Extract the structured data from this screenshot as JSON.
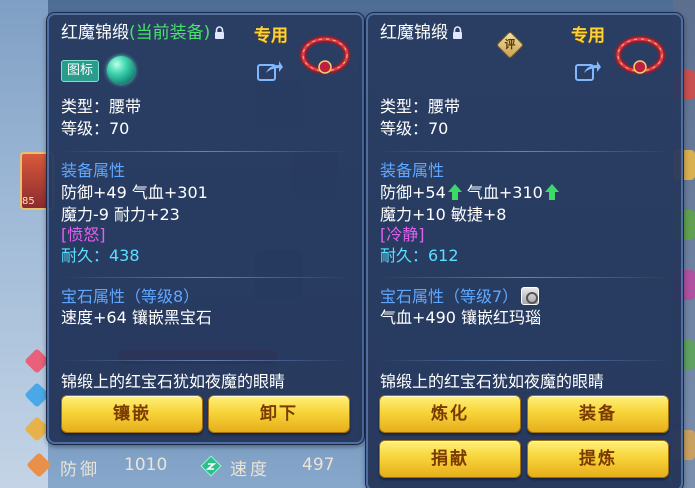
{
  "background": {
    "character_level": "85",
    "bottom_stats": [
      {
        "label": "防御",
        "value": "1010"
      },
      {
        "label": "速度",
        "value": "497"
      }
    ]
  },
  "left_panel": {
    "item_name": "红魔锦缎",
    "current_equipped": "(当前装备)",
    "exclusive": "专用",
    "tag": "图标",
    "type_line": "类型：腰带",
    "level_line": "等级：70",
    "attr_title": "装备属性",
    "attr_line1": "防御+49 气血+301",
    "attr_line2": "魔力-9 耐力+23",
    "trait": "[愤怒]",
    "durability": "耐久：438",
    "gem_title": "宝石属性（等级8）",
    "gem_line": "速度+64 镶嵌黑宝石",
    "flavor": "锦缎上的红宝石犹如夜魔的眼睛",
    "buttons": [
      "镶嵌",
      "卸下"
    ]
  },
  "right_panel": {
    "item_name": "红魔锦缎",
    "ping_badge": "评",
    "exclusive": "专用",
    "type_line": "类型：腰带",
    "level_line": "等级：70",
    "attr_title": "装备属性",
    "attr_line1_a": "防御+54",
    "attr_line1_b": "气血+310",
    "attr_line2": "魔力+10 敏捷+8",
    "trait": "[冷静]",
    "durability": "耐久：612",
    "gem_title": "宝石属性（等级7）",
    "gem_line": "气血+490 镶嵌红玛瑙",
    "flavor": "锦缎上的红宝石犹如夜魔的眼睛",
    "buttons": [
      "炼化",
      "装备",
      "捐献",
      "提炼"
    ]
  },
  "colors": {
    "current_equipped": "#49e06c",
    "section_title": "#5fa8ff",
    "trait": "#e060f0",
    "durability": "#59e0ff",
    "exclusive": "#ffd23a",
    "button": "#f7d43a"
  }
}
